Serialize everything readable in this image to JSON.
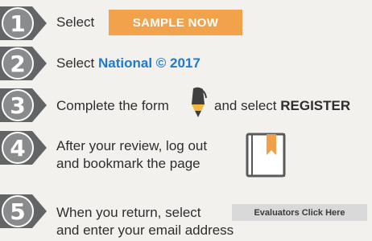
{
  "steps": [
    {
      "number": "1",
      "text": "Select"
    },
    {
      "number": "2",
      "text": "Select",
      "link": "National © 2017"
    },
    {
      "number": "3",
      "text": "Complete the form",
      "text2": "and select",
      "bold": "REGISTER"
    },
    {
      "number": "4",
      "line1": "After your review, log out",
      "line2": "and bookmark the page"
    },
    {
      "number": "5",
      "line1": "When you return, select",
      "line2": "and enter your email address"
    }
  ],
  "buttons": {
    "sample_now": "SAMPLE NOW",
    "evaluators": "Evaluators Click Here"
  },
  "icons": {
    "pen": "pen-icon",
    "bookmark": "bookmark-book-icon"
  },
  "colors": {
    "badge": "#636466",
    "sample_button": "#f2a24a",
    "link": "#1a7ad4",
    "bookmark_ribbon": "#f0a048",
    "pen_tip": "#f3b73f"
  }
}
